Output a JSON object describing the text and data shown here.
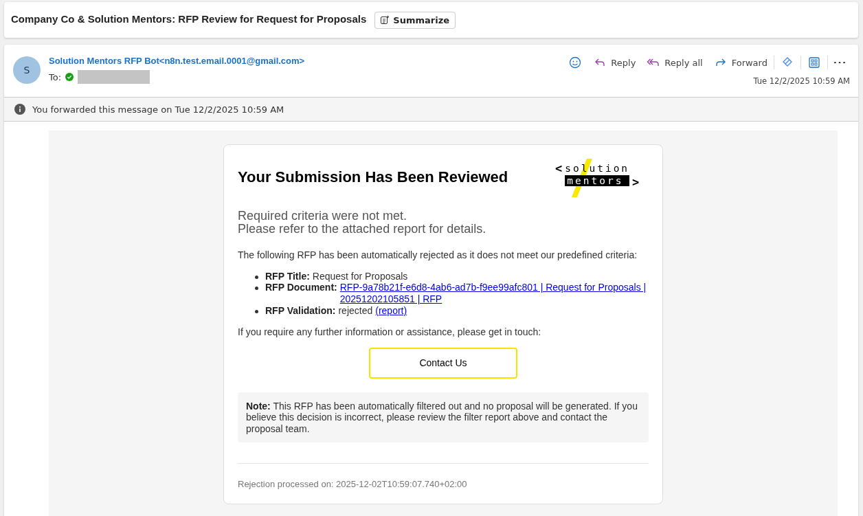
{
  "subject": "Company Co & Solution Mentors: RFP Review for Request for Proposals",
  "summarize_button": "Summarize",
  "message": {
    "avatar_initial": "S",
    "sender": "Solution Mentors RFP Bot<n8n.test.email.0001@gmail.com>",
    "to_label": "To:",
    "recipient_verified": true,
    "timestamp": "Tue 12/2/2025 10:59 AM",
    "actions": [
      {
        "kind": "emoji"
      },
      {
        "kind": "reply",
        "label": "Reply"
      },
      {
        "kind": "reply_all",
        "label": "Reply all"
      },
      {
        "kind": "forward",
        "label": "Forward"
      },
      {
        "kind": "loop"
      },
      {
        "kind": "apps"
      },
      {
        "kind": "more"
      }
    ],
    "notice": "You forwarded this message on Tue 12/2/2025 10:59 AM"
  },
  "email": {
    "heading": "Your Submission Has Been Reviewed",
    "logo": {
      "left": "<",
      "top": "solution",
      "bottom": "mentors",
      "right": ">"
    },
    "subheading": [
      "Required criteria were not met.",
      "Please refer to the attached report for details."
    ],
    "intro": "The following RFP has been automatically rejected as it does not meet our predefined criteria:",
    "items": [
      {
        "label": "RFP Title:",
        "value": "Request for Proposals"
      },
      {
        "label": "RFP Document:",
        "link": "RFP-9a78b21f-e6d8-4ab6-ad7b-f9ee99afc801 | Request for Proposals | 20251202105851 | RFP"
      },
      {
        "label": "RFP Validation:",
        "value": "rejected",
        "link": "(report)"
      }
    ],
    "prompt": "If you require any further information or assistance, please get in touch:",
    "button": "Contact Us",
    "note": "**Note:** This RFP has been automatically filtered out and no proposal will be generated. If you believe this decision is incorrect, please review the filter report above and contact the proposal team.",
    "footer": "Rejection processed on: 2025-12-02T10:59:07.740+02:00"
  }
}
